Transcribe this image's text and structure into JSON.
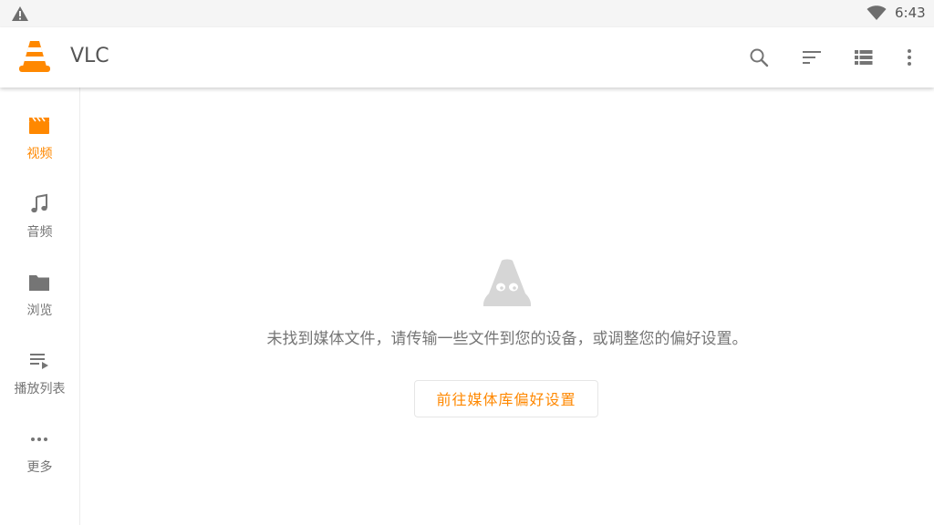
{
  "status_bar": {
    "time": "6:43",
    "warning_icon": "warning-icon",
    "wifi_icon": "wifi-icon"
  },
  "app_bar": {
    "title": "VLC",
    "logo_icon": "vlc-cone-icon",
    "actions": [
      "search-icon",
      "sort-icon",
      "list-view-icon",
      "more-vert-icon"
    ]
  },
  "sidebar": {
    "items": [
      {
        "label": "视频",
        "icon": "video-icon",
        "active": true
      },
      {
        "label": "音频",
        "icon": "music-note-icon",
        "active": false
      },
      {
        "label": "浏览",
        "icon": "folder-icon",
        "active": false
      },
      {
        "label": "播放列表",
        "icon": "playlist-icon",
        "active": false
      },
      {
        "label": "更多",
        "icon": "more-horiz-icon",
        "active": false
      }
    ]
  },
  "main": {
    "empty_icon": "vlc-ghost-cone-icon",
    "empty_message": "未找到媒体文件，请传输一些文件到您的设备，或调整您的偏好设置。",
    "pref_button_label": "前往媒体库偏好设置"
  },
  "colors": {
    "accent": "#ff8800",
    "text_secondary": "#757575",
    "icon_grey": "#757575",
    "empty_icon_grey": "#d6d6d6"
  }
}
